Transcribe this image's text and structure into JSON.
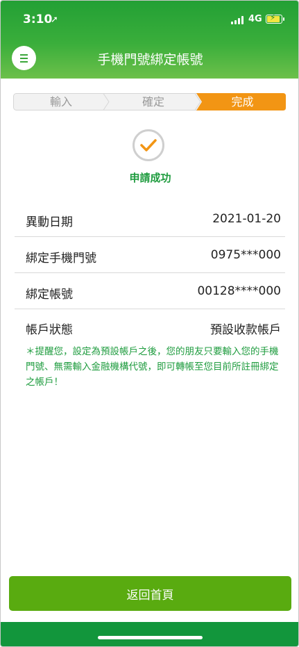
{
  "status_bar": {
    "time": "3:10",
    "network": "4G"
  },
  "header": {
    "title": "手機門號綁定帳號"
  },
  "stepper": {
    "steps": [
      "輸入",
      "確定",
      "完成"
    ],
    "active_color": "#f29514"
  },
  "result": {
    "message": "申請成功"
  },
  "details": [
    {
      "label": "異動日期",
      "value": "2021-01-20"
    },
    {
      "label": "綁定手機門號",
      "value": "0975***000"
    },
    {
      "label": "綁定帳號",
      "value": "00128****000"
    },
    {
      "label": "帳戶狀態",
      "value": "預設收款帳戶"
    }
  ],
  "note": "＊提醒您，設定為預設帳戶之後，您的朋友只要輸入您的手機門號、無需輸入金融機構代號，即可轉帳至您目前所註冊綁定之帳戶！",
  "actions": {
    "back_label": "返回首頁"
  },
  "colors": {
    "brand_green": "#3aae3b",
    "button_green": "#59ab10",
    "text_green": "#1f9c3f",
    "accent_orange": "#f29514"
  },
  "icons": [
    "menu-icon",
    "location-arrow-icon",
    "signal-icon",
    "battery-icon",
    "checkmark-icon"
  ]
}
